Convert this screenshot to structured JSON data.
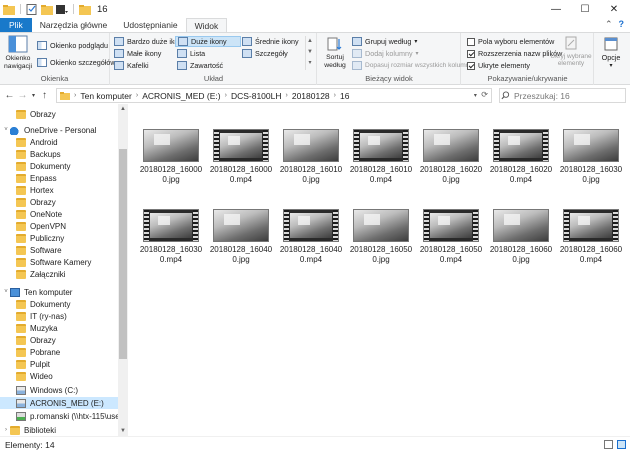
{
  "window": {
    "title": "16",
    "controls": {
      "minimize": "—",
      "maximize": "☐",
      "close": "✕"
    }
  },
  "tabs": [
    {
      "label": "Plik"
    },
    {
      "label": "Narzędzia główne"
    },
    {
      "label": "Udostępnianie"
    },
    {
      "label": "Widok"
    }
  ],
  "ribbon": {
    "panes": {
      "label": "Okienka",
      "nav_pane": "Okienko nawigacji",
      "preview": "Okienko podglądu",
      "details": "Okienko szczegółów"
    },
    "layout": {
      "label": "Układ",
      "items": [
        "Bardzo duże ikony",
        "Duże ikony",
        "Średnie ikony",
        "Małe ikony",
        "Lista",
        "Szczegóły",
        "Kafelki",
        "Zawartość"
      ],
      "selected": "Duże ikony"
    },
    "current_view": {
      "label": "Bieżący widok",
      "sort": "Sortuj według",
      "group": "Grupuj według",
      "add_columns": "Dodaj kolumny",
      "fit_columns": "Dopasuj rozmiar wszystkich kolumn"
    },
    "show_hide": {
      "label": "Pokazywanie/ukrywanie",
      "checkboxes": [
        {
          "label": "Pola wyboru elementów",
          "checked": false
        },
        {
          "label": "Rozszerzenia nazw plików",
          "checked": true
        },
        {
          "label": "Ukryte elementy",
          "checked": true
        }
      ],
      "hide_selected": "Ukryj wybrane elementy"
    },
    "options": "Opcje"
  },
  "address": {
    "crumbs": [
      "Ten komputer",
      "ACRONIS_MED (E:)",
      "DCS-8100LH",
      "20180128",
      "16"
    ],
    "search_placeholder": "Przeszukaj: 16"
  },
  "nav": {
    "items": [
      {
        "label": "Obrazy",
        "kind": "folder"
      },
      {
        "label": "OneDrive - Personal",
        "kind": "cloud"
      },
      {
        "label": "Android",
        "kind": "folder"
      },
      {
        "label": "Backups",
        "kind": "folder"
      },
      {
        "label": "Dokumenty",
        "kind": "folder"
      },
      {
        "label": "Enpass",
        "kind": "folder"
      },
      {
        "label": "Hortex",
        "kind": "folder"
      },
      {
        "label": "Obrazy",
        "kind": "folder"
      },
      {
        "label": "OneNote",
        "kind": "folder"
      },
      {
        "label": "OpenVPN",
        "kind": "folder"
      },
      {
        "label": "Publiczny",
        "kind": "folder"
      },
      {
        "label": "Software",
        "kind": "folder"
      },
      {
        "label": "Software Kamery",
        "kind": "folder"
      },
      {
        "label": "Załączniki",
        "kind": "folder"
      },
      {
        "label": "Ten komputer",
        "kind": "pc"
      },
      {
        "label": "Dokumenty",
        "kind": "folder"
      },
      {
        "label": "IT (ry-nas)",
        "kind": "folder"
      },
      {
        "label": "Muzyka",
        "kind": "folder"
      },
      {
        "label": "Obrazy",
        "kind": "folder"
      },
      {
        "label": "Pobrane",
        "kind": "folder"
      },
      {
        "label": "Pulpit",
        "kind": "folder"
      },
      {
        "label": "Wideo",
        "kind": "folder"
      },
      {
        "label": "Windows (C:)",
        "kind": "drive"
      },
      {
        "label": "ACRONIS_MED (E:)",
        "kind": "drive"
      },
      {
        "label": "p.romanski (\\\\htx-115\\users",
        "kind": "netdrive"
      },
      {
        "label": "Biblioteki",
        "kind": "folder"
      }
    ]
  },
  "files": [
    {
      "name": "20180128_160000.jpg",
      "type": "jpg"
    },
    {
      "name": "20180128_160000.mp4",
      "type": "mp4"
    },
    {
      "name": "20180128_160100.jpg",
      "type": "jpg"
    },
    {
      "name": "20180128_160100.mp4",
      "type": "mp4"
    },
    {
      "name": "20180128_160200.jpg",
      "type": "jpg"
    },
    {
      "name": "20180128_160200.mp4",
      "type": "mp4"
    },
    {
      "name": "20180128_160300.jpg",
      "type": "jpg"
    },
    {
      "name": "20180128_160300.mp4",
      "type": "mp4"
    },
    {
      "name": "20180128_160400.jpg",
      "type": "jpg"
    },
    {
      "name": "20180128_160400.mp4",
      "type": "mp4"
    },
    {
      "name": "20180128_160500.jpg",
      "type": "jpg"
    },
    {
      "name": "20180128_160500.mp4",
      "type": "mp4"
    },
    {
      "name": "20180128_160600.jpg",
      "type": "jpg"
    },
    {
      "name": "20180128_160600.mp4",
      "type": "mp4"
    }
  ],
  "status": {
    "count": "Elementy: 14"
  }
}
